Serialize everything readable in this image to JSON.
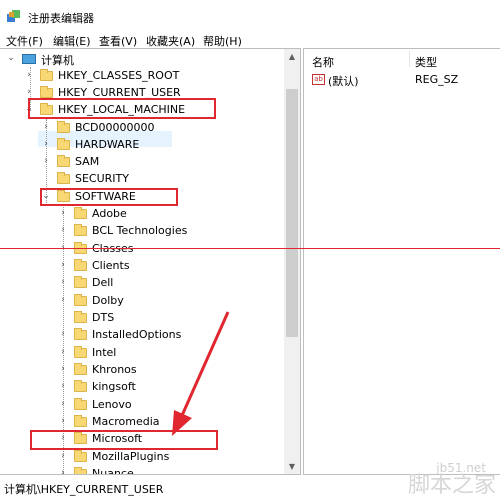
{
  "window": {
    "title": "注册表编辑器"
  },
  "menu": [
    "文件(F)",
    "编辑(E)",
    "查看(V)",
    "收藏夹(A)",
    "帮助(H)"
  ],
  "tree": {
    "root": "计算机",
    "hives": [
      "HKEY_CLASSES_ROOT",
      "HKEY_CURRENT_USER",
      "HKEY_LOCAL_MACHINE"
    ],
    "hklm_children": [
      "BCD00000000",
      "HARDWARE",
      "SAM",
      "SECURITY",
      "SOFTWARE"
    ],
    "software_children": [
      "Adobe",
      "BCL Technologies",
      "Classes",
      "Clients",
      "Dell",
      "Dolby",
      "DTS",
      "InstalledOptions",
      "Intel",
      "Khronos",
      "kingsoft",
      "Lenovo",
      "Macromedia",
      "Microsoft",
      "MozillaPlugins",
      "Nuance"
    ]
  },
  "list": {
    "columns": [
      "名称",
      "类型"
    ],
    "rows": [
      {
        "name": "(默认)",
        "type": "REG_SZ",
        "icon": "string-value-icon"
      }
    ]
  },
  "status": {
    "path": "计算机\\HKEY_CURRENT_USER"
  },
  "watermark": {
    "site": "jb51.net",
    "brand": "脚本之家"
  },
  "colors": {
    "annotation": "#e0262e",
    "folder": "#f8d775",
    "selection": "#e5f3ff"
  }
}
